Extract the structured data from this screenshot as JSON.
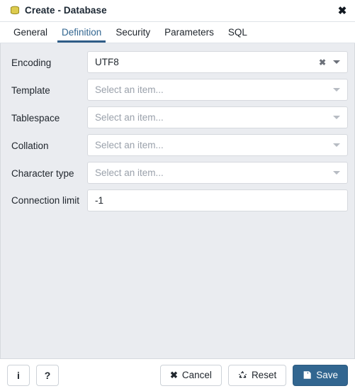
{
  "window": {
    "title": "Create - Database",
    "icon": "database-icon",
    "close_label": "✖"
  },
  "tabs": [
    {
      "label": "General",
      "active": false
    },
    {
      "label": "Definition",
      "active": true
    },
    {
      "label": "Security",
      "active": false
    },
    {
      "label": "Parameters",
      "active": false
    },
    {
      "label": "SQL",
      "active": false
    }
  ],
  "form": {
    "fields": [
      {
        "label": "Encoding",
        "type": "select",
        "value": "UTF8",
        "placeholder": "Select an item...",
        "has_clear": true,
        "clear_label": "✖"
      },
      {
        "label": "Template",
        "type": "select",
        "value": "",
        "placeholder": "Select an item...",
        "has_clear": false
      },
      {
        "label": "Tablespace",
        "type": "select",
        "value": "",
        "placeholder": "Select an item...",
        "has_clear": false
      },
      {
        "label": "Collation",
        "type": "select",
        "value": "",
        "placeholder": "Select an item...",
        "has_clear": false
      },
      {
        "label": "Character type",
        "type": "select",
        "value": "",
        "placeholder": "Select an item...",
        "has_clear": false
      },
      {
        "label": "Connection limit",
        "type": "text",
        "value": "-1",
        "placeholder": "",
        "has_clear": false
      }
    ]
  },
  "footer": {
    "info_label": "i",
    "help_label": "?",
    "cancel_label": "Cancel",
    "cancel_icon": "close-icon",
    "reset_label": "Reset",
    "reset_icon": "recycle-icon",
    "save_label": "Save",
    "save_icon": "floppy-disk-icon"
  },
  "colors": {
    "accent": "#326690",
    "body_bg": "#eaecf0",
    "panel_bg": "#ffffff",
    "border": "#d6d9de",
    "placeholder_text": "#9aa1ab",
    "db_icon": "#d9c441"
  }
}
